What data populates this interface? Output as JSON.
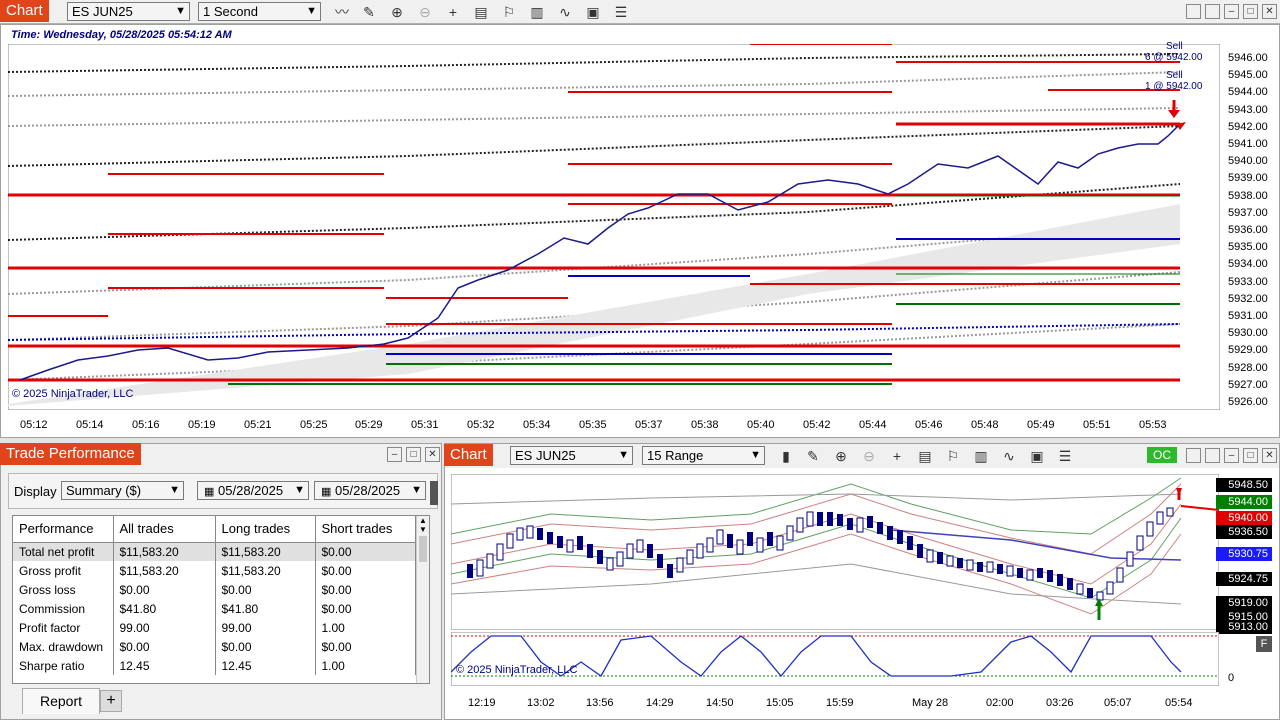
{
  "top_chart": {
    "tab_label": "Chart",
    "instrument": "ES JUN25",
    "interval": "1 Second",
    "time_line": "Time: Wednesday, 05/28/2025 05:54:12 AM",
    "copyright": "© 2025 NinjaTrader, LLC",
    "y_ticks": [
      "5946.00",
      "5945.00",
      "5944.00",
      "5943.00",
      "5942.00",
      "5941.00",
      "5940.00",
      "5939.00",
      "5938.00",
      "5937.00",
      "5936.00",
      "5935.00",
      "5934.00",
      "5933.00",
      "5932.00",
      "5931.00",
      "5930.00",
      "5929.00",
      "5928.00",
      "5927.00",
      "5926.00"
    ],
    "x_ticks": [
      "05:12",
      "05:14",
      "05:16",
      "05:19",
      "05:21",
      "05:25",
      "05:29",
      "05:31",
      "05:32",
      "05:34",
      "05:35",
      "05:37",
      "05:38",
      "05:40",
      "05:42",
      "05:44",
      "05:46",
      "05:48",
      "05:49",
      "05:51",
      "05:53"
    ],
    "trade_marker_1_title": "Sell",
    "trade_marker_1_detail": "6 @ 5942.00",
    "trade_marker_2_title": "Sell",
    "trade_marker_2_detail": "1 @ 5942.00",
    "colors": {
      "sell_line": "#e00000",
      "buy_line": "#0000c0",
      "green_line": "#007000",
      "price": "#1a1a8c"
    }
  },
  "trade_perf": {
    "tab_label": "Trade Performance",
    "display_label": "Display",
    "display_value": "Summary ($)",
    "date_from": "05/28/2025",
    "date_to": "05/28/2025",
    "headers": [
      "Performance",
      "All trades",
      "Long trades",
      "Short trades"
    ],
    "rows": [
      [
        "Total net profit",
        "$11,583.20",
        "$11,583.20",
        "$0.00"
      ],
      [
        "Gross profit",
        "$11,583.20",
        "$11,583.20",
        "$0.00"
      ],
      [
        "Gross loss",
        "$0.00",
        "$0.00",
        "$0.00"
      ],
      [
        "Commission",
        "$41.80",
        "$41.80",
        "$0.00"
      ],
      [
        "Profit factor",
        "99.00",
        "99.00",
        "1.00"
      ],
      [
        "Max. drawdown",
        "$0.00",
        "$0.00",
        "$0.00"
      ],
      [
        "Sharpe ratio",
        "12.45",
        "12.45",
        "1.00"
      ]
    ],
    "bottom_tab": "Report",
    "add_tab": "+"
  },
  "bottom_chart": {
    "tab_label": "Chart",
    "instrument": "ES JUN25",
    "interval": "15 Range",
    "oc_badge": "OC",
    "copyright": "© 2025 NinjaTrader, LLC",
    "price_labels": [
      {
        "text": "5948.50",
        "bg": "#000000"
      },
      {
        "text": "5944.00",
        "bg": "#008000"
      },
      {
        "text": "5940.00",
        "bg": "#e00000"
      },
      {
        "text": "5936.50",
        "bg": "#000000"
      },
      {
        "text": "5930.75",
        "bg": "#1a1aff"
      },
      {
        "text": "5924.75",
        "bg": "#000000"
      },
      {
        "text": "5919.00",
        "bg": "#000000"
      },
      {
        "text": "5915.00",
        "bg": "#000000"
      },
      {
        "text": "5913.00",
        "bg": "#000000"
      }
    ],
    "x_ticks": [
      "12:19",
      "13:02",
      "13:56",
      "14:29",
      "14:50",
      "15:05",
      "15:59",
      "May 28",
      "02:00",
      "03:26",
      "05:07",
      "05:54"
    ],
    "indicator_zero": "0",
    "indicator_f": "F"
  }
}
